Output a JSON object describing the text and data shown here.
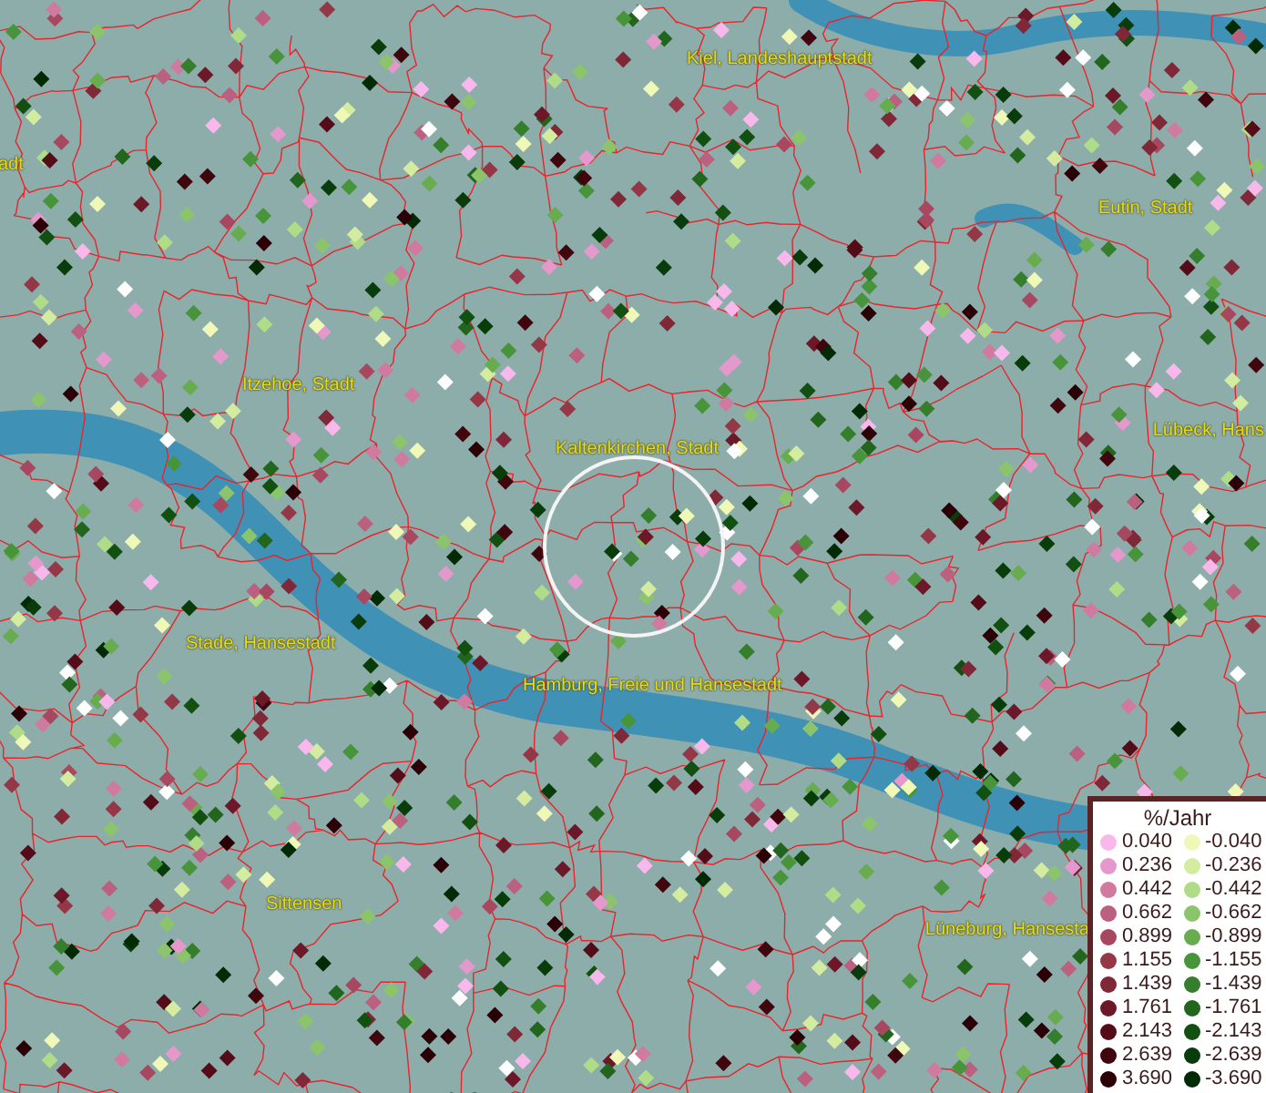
{
  "map": {
    "places": [
      {
        "name": "Kiel, Landeshauptstadt"
      },
      {
        "name": "adt"
      },
      {
        "name": "Eutin, Stadt"
      },
      {
        "name": "Itzehoe, Stadt"
      },
      {
        "name": "Lübeck, Hans"
      },
      {
        "name": "Kaltenkirchen, Stadt"
      },
      {
        "name": "Stade, Hansestadt"
      },
      {
        "name": "Hamburg, Freie und Hansestadt"
      },
      {
        "name": "Sittensen"
      },
      {
        "name": "Lüneburg, Hansesta"
      }
    ]
  },
  "legend": {
    "title": "%/Jahr",
    "entries": [
      {
        "value": "0.040",
        "color": "#f8b8ec"
      },
      {
        "value": "-0.040",
        "color": "#f0f8b8"
      },
      {
        "value": "0.236",
        "color": "#e498cc"
      },
      {
        "value": "-0.236",
        "color": "#d4eca0"
      },
      {
        "value": "0.442",
        "color": "#d07aa0"
      },
      {
        "value": "-0.442",
        "color": "#b0dc88"
      },
      {
        "value": "0.662",
        "color": "#bc6080"
      },
      {
        "value": "-0.662",
        "color": "#8cc46c"
      },
      {
        "value": "0.899",
        "color": "#a84860"
      },
      {
        "value": "-0.899",
        "color": "#68ac50"
      },
      {
        "value": "1.155",
        "color": "#943848"
      },
      {
        "value": "-1.155",
        "color": "#48943a"
      },
      {
        "value": "1.439",
        "color": "#802838"
      },
      {
        "value": "-1.439",
        "color": "#347e2c"
      },
      {
        "value": "1.761",
        "color": "#6c1828"
      },
      {
        "value": "-1.761",
        "color": "#22661e"
      },
      {
        "value": "2.143",
        "color": "#540c18"
      },
      {
        "value": "-2.143",
        "color": "#125012"
      },
      {
        "value": "2.639",
        "color": "#40060e"
      },
      {
        "value": "-2.639",
        "color": "#083c0a"
      },
      {
        "value": "3.690",
        "color": "#2a0006"
      },
      {
        "value": "-3.690",
        "color": "#022a04"
      }
    ]
  }
}
